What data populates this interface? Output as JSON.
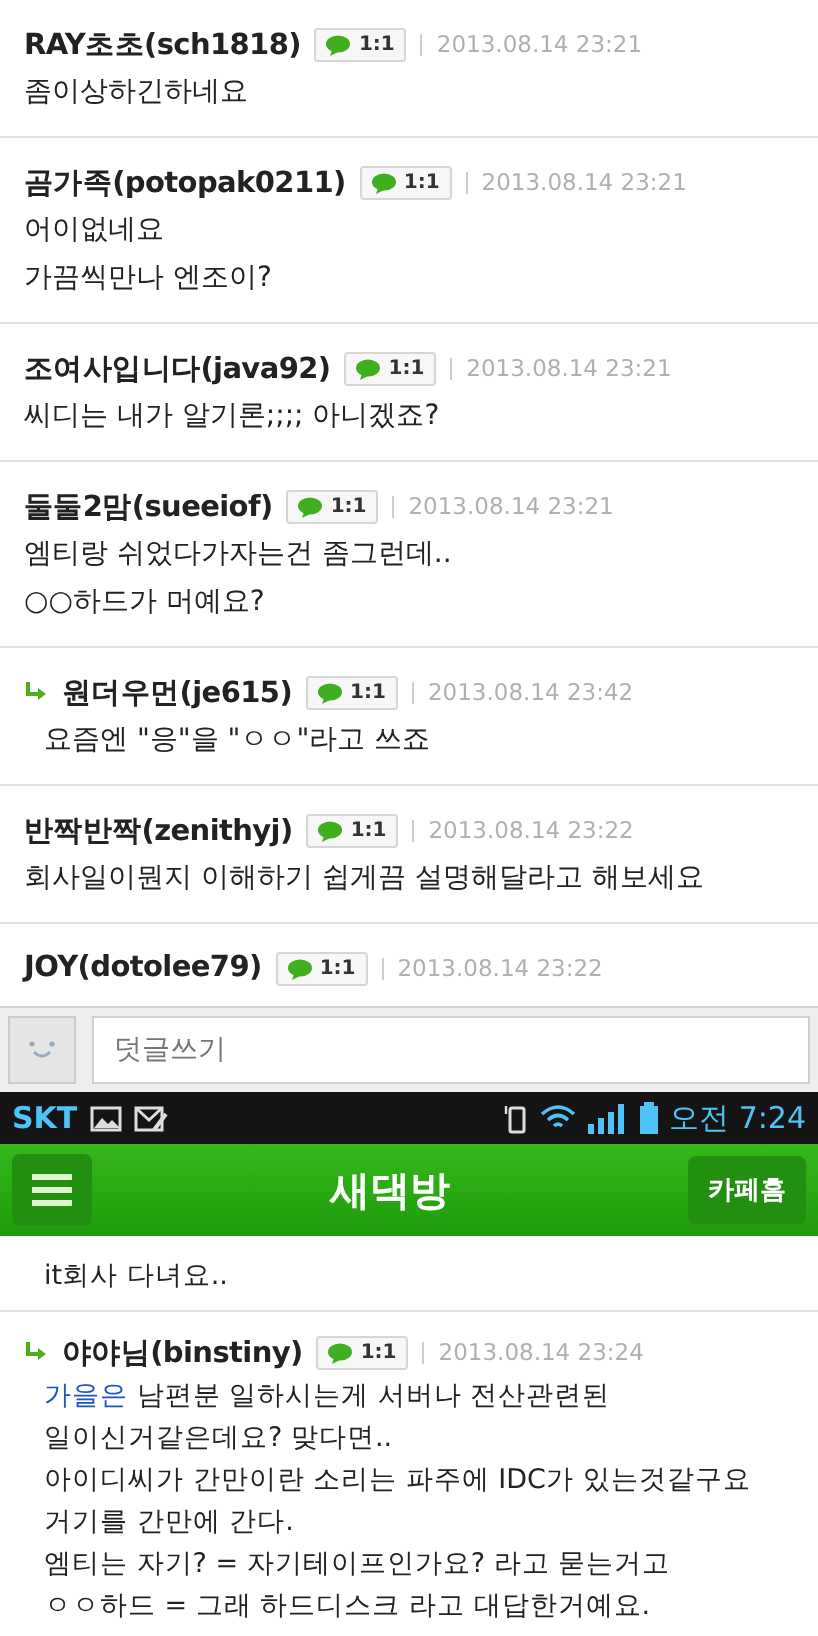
{
  "comments": [
    {
      "kind": "comment",
      "author": "RAY초초(sch1818)",
      "badge": "1:1",
      "date": "2013.08.14 23:21",
      "lines": [
        "좀이상하긴하네요"
      ]
    },
    {
      "kind": "comment",
      "author": "곰가족(potopak0211)",
      "badge": "1:1",
      "date": "2013.08.14 23:21",
      "lines": [
        "어이없네요",
        "가끔씩만나 엔조이?"
      ]
    },
    {
      "kind": "comment",
      "author": "조여사입니다(java92)",
      "badge": "1:1",
      "date": "2013.08.14 23:21",
      "lines": [
        "씨디는 내가 알기론;;;; 아니겠죠?"
      ]
    },
    {
      "kind": "comment",
      "author": "둘둘2맘(sueeiof)",
      "badge": "1:1",
      "date": "2013.08.14 23:21",
      "lines": [
        "엠티랑 쉬었다가자는건 좀그런데..",
        "○○하드가 머예요?"
      ]
    },
    {
      "kind": "reply",
      "author": "원더우먼(je615)",
      "badge": "1:1",
      "date": "2013.08.14 23:42",
      "lines": [
        "요즘엔 \"응\"을 \"ㅇㅇ\"라고 쓰죠"
      ]
    },
    {
      "kind": "comment",
      "author": "반짝반짝(zenithyj)",
      "badge": "1:1",
      "date": "2013.08.14 23:22",
      "lines": [
        "회사일이뭔지 이해하기 쉽게끔 설명해달라고 해보세요"
      ]
    },
    {
      "kind": "comment",
      "author": "JOY(dotolee79)",
      "badge": "1:1",
      "date": "2013.08.14 23:22"
    }
  ],
  "reply_box": {
    "placeholder": "덧글쓰기"
  },
  "status_bar": {
    "carrier": "SKT",
    "time": "오전 7:24"
  },
  "app_bar": {
    "title": "새댁방",
    "button": "카페홈"
  },
  "comments_2": [
    {
      "kind": "partial",
      "lines": [
        "it회사 다녀요.."
      ]
    },
    {
      "kind": "reply",
      "author": "야야님(binstiny)",
      "badge": "1:1",
      "date": "2013.08.14 23:24",
      "mention": "가을은",
      "lines": [
        " 남편분 일하시는게 서버나 전산관련된",
        "일이신거같은데요? 맞다면..",
        "아이디씨가 간만이란 소리는 파주에 IDC가 있는것같구요",
        "거기를 간만에 간다.",
        "엠티는 자기? = 자기테이프인가요? 라고 묻는거고",
        "ㅇㅇ하드 = 그래 하드디스크 라고 대답한거예요."
      ]
    }
  ]
}
